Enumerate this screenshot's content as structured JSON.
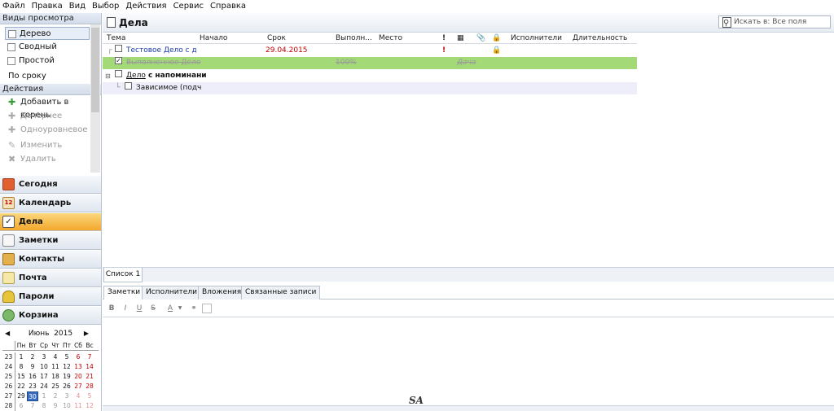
{
  "menu": [
    "Файл",
    "Правка",
    "Вид",
    "Выбор",
    "Действия",
    "Сервис",
    "Справка"
  ],
  "views": {
    "header": "Виды просмотра",
    "items": [
      {
        "label": "Дерево",
        "selected": true
      },
      {
        "label": "Сводный",
        "selected": false
      },
      {
        "label": "Простой",
        "selected": false
      },
      {
        "label": "По сроку выполнения",
        "selected": false
      }
    ]
  },
  "actions": {
    "header": "Действия",
    "items": [
      {
        "label": "Добавить в корень",
        "enabled": true,
        "icon": "add-icon"
      },
      {
        "label": "Дочернее",
        "enabled": false,
        "icon": "add-child-icon"
      },
      {
        "label": "Одноуровневое",
        "enabled": false,
        "icon": "add-sibling-icon"
      },
      {
        "label": "Изменить",
        "enabled": false,
        "icon": "edit-icon"
      },
      {
        "label": "Удалить",
        "enabled": false,
        "icon": "delete-icon"
      }
    ]
  },
  "nav": [
    {
      "label": "Сегодня",
      "icon": "today-icon",
      "color": "#e06030"
    },
    {
      "label": "Календарь",
      "icon": "calendar-icon",
      "color": "#d9b06a"
    },
    {
      "label": "Дела",
      "icon": "tasks-icon",
      "color": "#ffffff",
      "active": true
    },
    {
      "label": "Заметки",
      "icon": "notes-icon",
      "color": "#f7f7f7"
    },
    {
      "label": "Контакты",
      "icon": "contacts-icon",
      "color": "#e3b04c"
    },
    {
      "label": "Почта",
      "icon": "mail-icon",
      "color": "#f6e9a8"
    },
    {
      "label": "Пароли",
      "icon": "lock-icon",
      "color": "#e8c43a"
    },
    {
      "label": "Корзина",
      "icon": "recycle-bin-icon",
      "color": "#7cb86a"
    }
  ],
  "calendar": {
    "month": "Июнь",
    "year": "2015",
    "weekdays": [
      "Пн",
      "Вт",
      "Ср",
      "Чт",
      "Пт",
      "Сб",
      "Вс"
    ],
    "weeks": [
      {
        "num": "23",
        "days": [
          "1",
          "2",
          "3",
          "4",
          "5",
          "6",
          "7"
        ],
        "gray": [
          false,
          false,
          false,
          false,
          false,
          false,
          false
        ]
      },
      {
        "num": "24",
        "days": [
          "8",
          "9",
          "10",
          "11",
          "12",
          "13",
          "14"
        ],
        "gray": [
          false,
          false,
          false,
          false,
          false,
          false,
          false
        ]
      },
      {
        "num": "25",
        "days": [
          "15",
          "16",
          "17",
          "18",
          "19",
          "20",
          "21"
        ],
        "gray": [
          false,
          false,
          false,
          false,
          false,
          false,
          false
        ]
      },
      {
        "num": "26",
        "days": [
          "22",
          "23",
          "24",
          "25",
          "26",
          "27",
          "28"
        ],
        "gray": [
          false,
          false,
          false,
          false,
          false,
          false,
          false
        ]
      },
      {
        "num": "27",
        "days": [
          "29",
          "30",
          "1",
          "2",
          "3",
          "4",
          "5"
        ],
        "gray": [
          false,
          false,
          true,
          true,
          true,
          true,
          true
        ]
      },
      {
        "num": "28",
        "days": [
          "6",
          "7",
          "8",
          "9",
          "10",
          "11",
          "12"
        ],
        "gray": [
          true,
          true,
          true,
          true,
          true,
          true,
          true
        ]
      }
    ],
    "today": "30"
  },
  "main": {
    "title": "Дела",
    "search_placeholder": "Искать в: Все поля"
  },
  "columns": {
    "subject": "Тема",
    "start": "Начало",
    "due": "Срок",
    "completed": "Выполн...",
    "place": "Место",
    "priority": "!",
    "attach": "⊘",
    "lock": "🔒",
    "assignees": "Исполнители",
    "duration": "Длительность"
  },
  "tasks": [
    {
      "subject": "Тестовое Дело с датой",
      "due": "29.04.2015",
      "priority": "!",
      "private": "🔒",
      "checked": false,
      "style": "normal"
    },
    {
      "subject": "Выполненное Дело",
      "completed": "100%",
      "duration": "Дача",
      "checked": true,
      "style": "done"
    },
    {
      "subject_prefix": "Дело",
      "subject_rest": "с напоминани",
      "checked": false,
      "style": "bold"
    },
    {
      "subject": "Зависимое (подч",
      "checked": false,
      "style": "child"
    }
  ],
  "bottom": {
    "list_tab": "Список 1",
    "tabs": [
      "Заметки",
      "Исполнители",
      "Вложения",
      "Связанные записи"
    ],
    "format": [
      "B",
      "I",
      "U",
      "S",
      "A"
    ]
  },
  "colors": {
    "done_row": "#a3d977",
    "overdue": "#c00000",
    "link": "#1a3aa8",
    "active_nav": "#f6b94a"
  },
  "signature": "SA"
}
